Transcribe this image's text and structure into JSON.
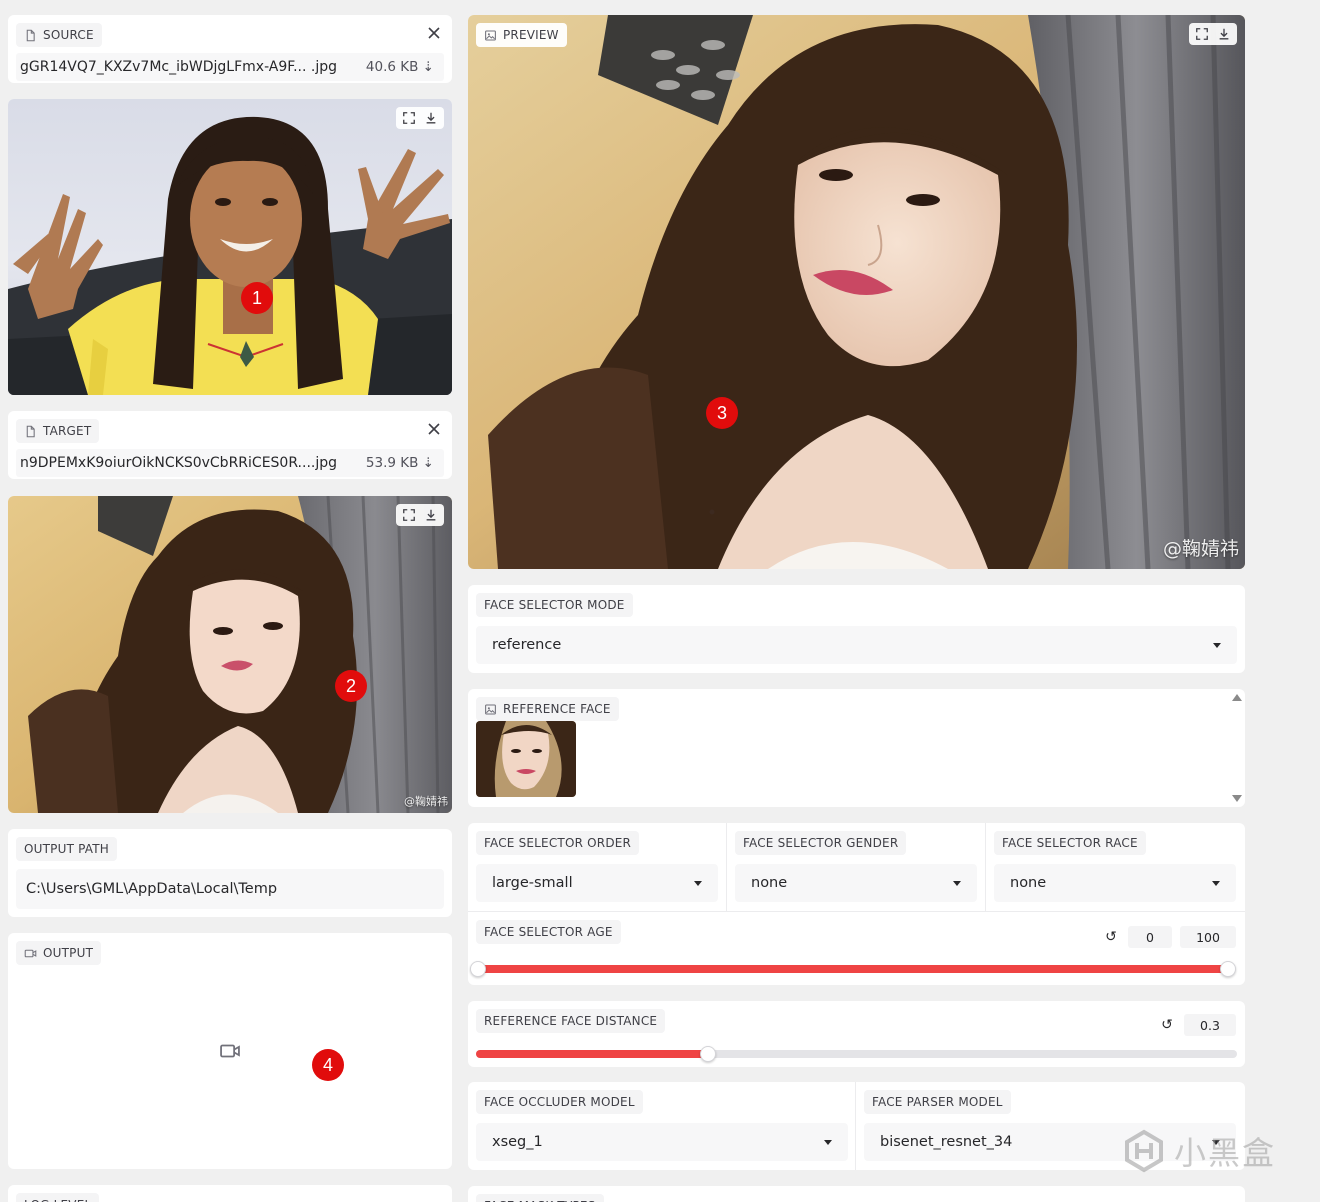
{
  "source": {
    "label": "SOURCE",
    "file_name": "gGR14VQ7_KXZv7Mc_ibWDjgLFmx-A9F... .jpg",
    "file_size": "40.6 KB ⇣"
  },
  "target": {
    "label": "TARGET",
    "file_name": "n9DPEMxK9oiurOikNCKS0vCbRRiCES0R....jpg",
    "file_size": "53.9 KB ⇣"
  },
  "preview": {
    "label": "PREVIEW",
    "watermark": "@鞠婧祎"
  },
  "target_watermark": "@鞠婧祎",
  "output_path": {
    "label": "OUTPUT PATH",
    "value": "C:\\Users\\GML\\AppData\\Local\\Temp"
  },
  "output": {
    "label": "OUTPUT"
  },
  "log_level": {
    "label": "LOG LEVEL"
  },
  "face_selector_mode": {
    "label": "FACE SELECTOR MODE",
    "value": "reference"
  },
  "reference_face": {
    "label": "REFERENCE FACE"
  },
  "face_selector_order": {
    "label": "FACE SELECTOR ORDER",
    "value": "large-small"
  },
  "face_selector_gender": {
    "label": "FACE SELECTOR GENDER",
    "value": "none"
  },
  "face_selector_race": {
    "label": "FACE SELECTOR RACE",
    "value": "none"
  },
  "face_selector_age": {
    "label": "FACE SELECTOR AGE",
    "min_value": "0",
    "max_value": "100",
    "reset_icon": "↺",
    "range_fraction": [
      0.0,
      1.0
    ]
  },
  "reference_face_distance": {
    "label": "REFERENCE FACE DISTANCE",
    "value": "0.3",
    "reset_icon": "↺",
    "fraction": 0.305
  },
  "face_occluder_model": {
    "label": "FACE OCCLUDER MODEL",
    "value": "xseg_1"
  },
  "face_parser_model": {
    "label": "FACE PARSER MODEL",
    "value": "bisenet_resnet_34"
  },
  "face_mask_types": {
    "label": "FACE MASK TYPES"
  },
  "annotations": [
    "1",
    "2",
    "3",
    "4"
  ],
  "brand_watermark": "小黑盒",
  "colors": {
    "accent": "#ef4444",
    "marker": "#e10c0c",
    "panel": "#ffffff",
    "background": "#f0f0f0"
  }
}
